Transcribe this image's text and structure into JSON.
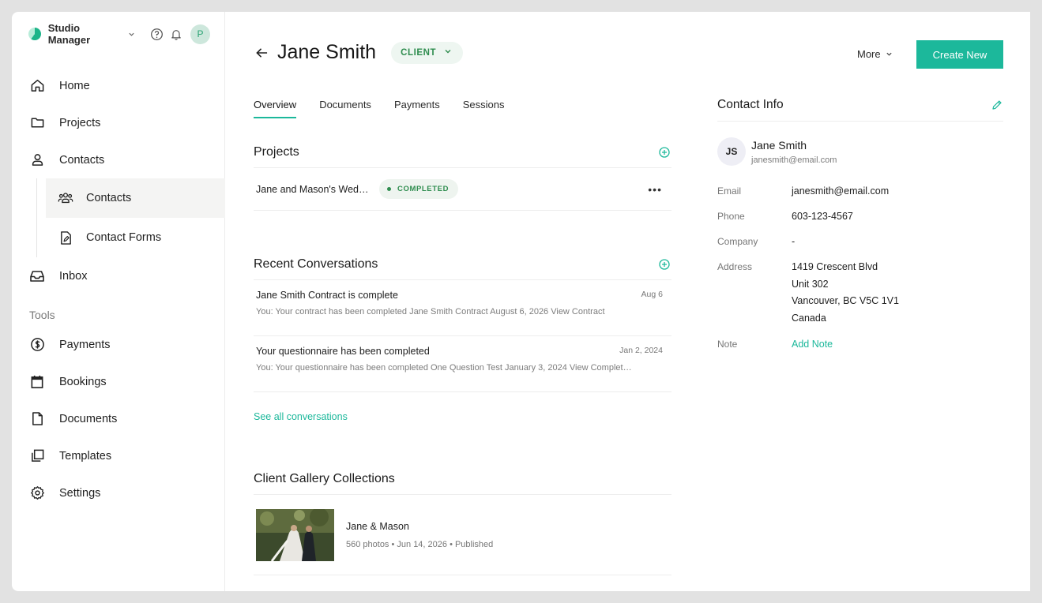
{
  "sidebar": {
    "brand": "Studio Manager",
    "avatar_initial": "P",
    "nav": [
      {
        "label": "Home",
        "icon": "home-icon"
      },
      {
        "label": "Projects",
        "icon": "folder-icon"
      },
      {
        "label": "Contacts",
        "icon": "person-icon"
      }
    ],
    "contacts_sub": [
      {
        "label": "Contacts",
        "icon": "people-icon",
        "active": true
      },
      {
        "label": "Contact Forms",
        "icon": "form-icon"
      }
    ],
    "inbox": {
      "label": "Inbox",
      "icon": "inbox-icon"
    },
    "tools_label": "Tools",
    "tools": [
      {
        "label": "Payments",
        "icon": "dollar-icon"
      },
      {
        "label": "Bookings",
        "icon": "calendar-icon"
      },
      {
        "label": "Documents",
        "icon": "document-icon"
      },
      {
        "label": "Templates",
        "icon": "templates-icon"
      },
      {
        "label": "Settings",
        "icon": "gear-icon"
      }
    ]
  },
  "header": {
    "title": "Jane Smith",
    "badge": "CLIENT",
    "more_label": "More",
    "create_label": "Create New"
  },
  "tabs": [
    {
      "label": "Overview",
      "active": true
    },
    {
      "label": "Documents"
    },
    {
      "label": "Payments"
    },
    {
      "label": "Sessions"
    }
  ],
  "projects": {
    "title": "Projects",
    "items": [
      {
        "name": "Jane and Mason's Wedding",
        "status": "COMPLETED"
      }
    ]
  },
  "conversations": {
    "title": "Recent Conversations",
    "items": [
      {
        "title": "Jane Smith Contract is complete",
        "date": "Aug 6",
        "preview": "You: Your contract has been completed Jane Smith Contract August 6, 2026 View Contract"
      },
      {
        "title": "Your questionnaire has been completed",
        "date": "Jan 2, 2024",
        "preview": "You: Your questionnaire has been completed One Question Test January 3, 2024 View Completed Questionnaire"
      }
    ],
    "see_all": "See all conversations"
  },
  "gallery": {
    "title": "Client Gallery Collections",
    "items": [
      {
        "title": "Jane & Mason",
        "meta": "560 photos • Jun 14, 2026 • Published"
      }
    ]
  },
  "contact": {
    "title": "Contact Info",
    "initials": "JS",
    "name": "Jane Smith",
    "email_sub": "janesmith@email.com",
    "rows": {
      "email": {
        "label": "Email",
        "value": "janesmith@email.com"
      },
      "phone": {
        "label": "Phone",
        "value": "603-123-4567"
      },
      "company": {
        "label": "Company",
        "value": "-"
      },
      "address": {
        "label": "Address",
        "lines": [
          "1419 Crescent Blvd",
          "Unit 302",
          "Vancouver, BC V5C 1V1",
          "Canada"
        ]
      },
      "note": {
        "label": "Note",
        "value": "Add Note"
      }
    }
  },
  "colors": {
    "accent": "#1cb89b",
    "status_green": "#2f8d4f"
  }
}
